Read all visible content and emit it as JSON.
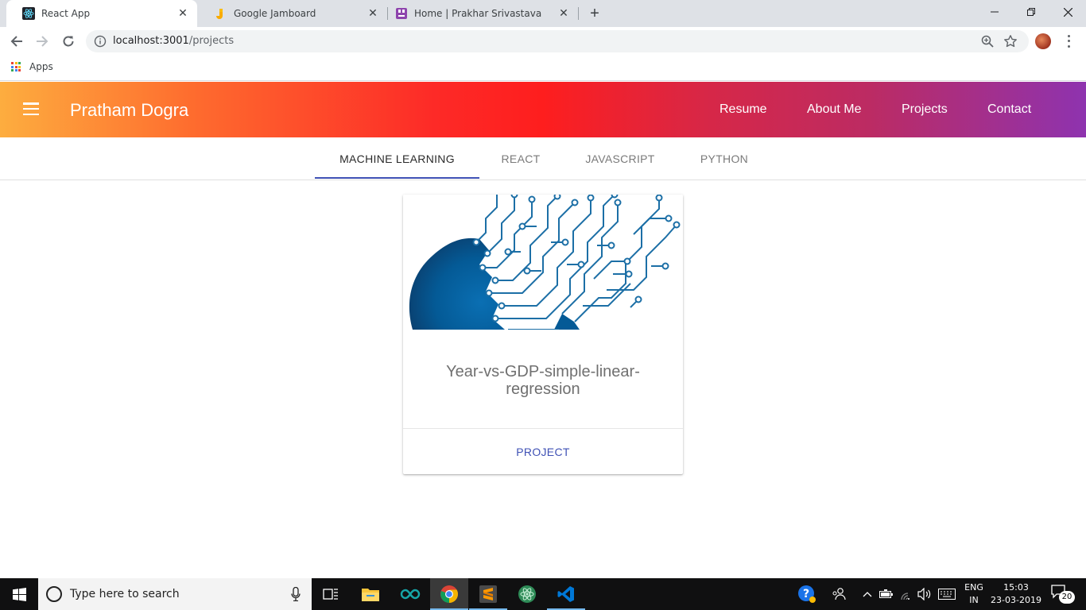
{
  "browser": {
    "tabs": [
      {
        "title": "React App",
        "favicon": "react-icon"
      },
      {
        "title": "Google Jamboard",
        "favicon": "jamboard-icon"
      },
      {
        "title": "Home | Prakhar Srivastava",
        "favicon": "site-icon"
      }
    ],
    "url_host": "localhost:3001",
    "url_path": "/projects",
    "bookmarks": {
      "apps_label": "Apps"
    }
  },
  "app": {
    "brand": "Pratham Dogra",
    "nav": [
      "Resume",
      "About Me",
      "Projects",
      "Contact"
    ],
    "categories": [
      "MACHINE LEARNING",
      "REACT",
      "JAVASCRIPT",
      "PYTHON"
    ],
    "active_category": "MACHINE LEARNING",
    "project": {
      "title": "Year-vs-GDP-simple-linear-regression",
      "action_label": "PROJECT",
      "image": "circuit-brain-illustration"
    },
    "colors": {
      "header_gradient": [
        "#fdad3f",
        "#fe1e1e",
        "#8e33af"
      ],
      "accent": "#3f51b5"
    }
  },
  "taskbar": {
    "search_placeholder": "Type here to search",
    "lang_top": "ENG",
    "lang_bottom": "IN",
    "time": "15:03",
    "date": "23-03-2019",
    "notifications": "20"
  }
}
